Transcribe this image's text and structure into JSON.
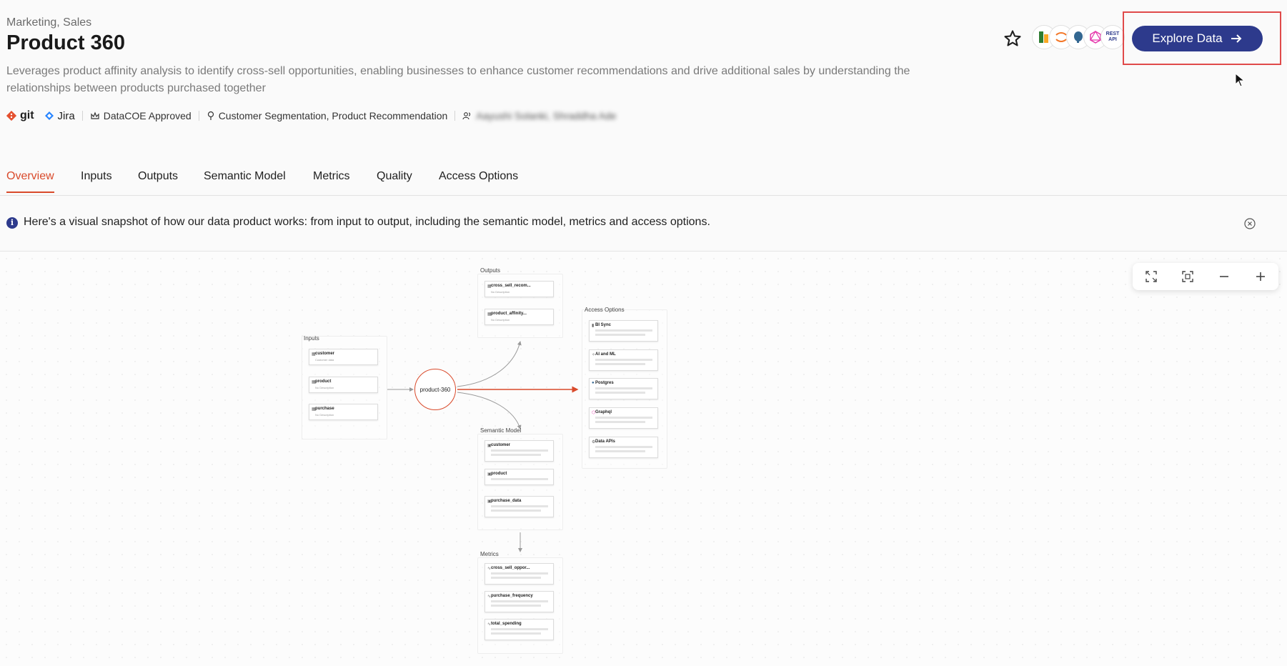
{
  "header": {
    "breadcrumb": "Marketing, Sales",
    "title": "Product 360",
    "description": "Leverages product affinity analysis to identify cross-sell opportunities, enabling businesses to enhance customer recommendations and drive additional sales by understanding the relationships between products purchased together",
    "meta": {
      "git": "git",
      "jira": "Jira",
      "approval": "DataCOE Approved",
      "use_cases": "Customer Segmentation, Product Recommendation",
      "owners": "Aayushi Solanki, Shraddha Ade"
    },
    "explore_button": "Explore Data",
    "tool_icons": [
      "excel",
      "jupyter",
      "postgres",
      "graphql",
      "rest-api"
    ],
    "tool_icon_labels": [
      "",
      "",
      "",
      "",
      "REST API"
    ]
  },
  "tabs": [
    "Overview",
    "Inputs",
    "Outputs",
    "Semantic Model",
    "Metrics",
    "Quality",
    "Access Options"
  ],
  "active_tab": "Overview",
  "notice": {
    "text": "Here's a visual snapshot of how our data product works: from input to output, including the semantic model, metrics and access options."
  },
  "diagram": {
    "hub": "product-360",
    "inputs": {
      "label": "Inputs",
      "items": [
        {
          "name": "customer",
          "sub": "Customer data"
        },
        {
          "name": "product",
          "sub": "No Description"
        },
        {
          "name": "purchase",
          "sub": "No Description"
        }
      ]
    },
    "outputs": {
      "label": "Outputs",
      "items": [
        {
          "name": "cross_sell_recom...",
          "sub": "No Description"
        },
        {
          "name": "product_affinity...",
          "sub": "No Description"
        }
      ]
    },
    "semantic_model": {
      "label": "Semantic Model",
      "items": [
        {
          "name": "customer"
        },
        {
          "name": "product"
        },
        {
          "name": "purchase_data"
        }
      ]
    },
    "metrics": {
      "label": "Metrics",
      "items": [
        {
          "name": "cross_sell_oppor..."
        },
        {
          "name": "purchase_frequency"
        },
        {
          "name": "total_spending"
        }
      ]
    },
    "access_options": {
      "label": "Access Options",
      "items": [
        {
          "name": "BI Sync"
        },
        {
          "name": "AI and ML"
        },
        {
          "name": "Postgres"
        },
        {
          "name": "Graphql"
        },
        {
          "name": "Data APIs"
        }
      ]
    }
  },
  "colors": {
    "accent": "#d94a2b",
    "primary_button": "#2d3a8c",
    "highlight_box": "#e04a4a"
  }
}
